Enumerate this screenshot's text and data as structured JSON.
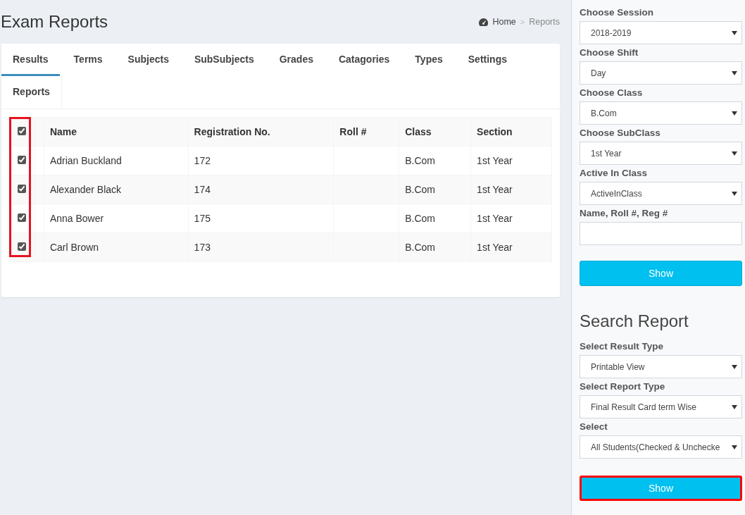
{
  "page": {
    "title": "Exam Reports",
    "breadcrumb": [
      {
        "label": "Home",
        "kind": "link"
      },
      {
        "label": "Reports",
        "kind": "current"
      }
    ],
    "breadcrumb_separator": ">"
  },
  "tabs": [
    {
      "label": "Results",
      "selected": true
    },
    {
      "label": "Terms",
      "selected": false
    },
    {
      "label": "Subjects",
      "selected": false
    },
    {
      "label": "SubSubjects",
      "selected": false
    },
    {
      "label": "Grades",
      "selected": false
    },
    {
      "label": "Catagories",
      "selected": false
    },
    {
      "label": "Types",
      "selected": false
    },
    {
      "label": "Settings",
      "selected": false
    },
    {
      "label": "Reports",
      "selected": false
    }
  ],
  "table": {
    "select_all_checked": true,
    "checkbox_column_highlighted": true,
    "columns": [
      "Name",
      "Registration No.",
      "Roll #",
      "Class",
      "Section"
    ],
    "rows": [
      {
        "checked": true,
        "cells": [
          "Adrian Buckland",
          "172",
          "",
          "B.Com",
          "1st Year"
        ]
      },
      {
        "checked": true,
        "cells": [
          "Alexander Black",
          "174",
          "",
          "B.Com",
          "1st Year"
        ]
      },
      {
        "checked": true,
        "cells": [
          "Anna Bower",
          "175",
          "",
          "B.Com",
          "1st Year"
        ]
      },
      {
        "checked": true,
        "cells": [
          "Carl Brown",
          "173",
          "",
          "B.Com",
          "1st Year"
        ]
      }
    ]
  },
  "sidebar": {
    "filters": [
      {
        "label": "Choose Session",
        "kind": "select",
        "value": "2018-2019"
      },
      {
        "label": "Choose Shift",
        "kind": "select",
        "value": "Day"
      },
      {
        "label": "Choose Class",
        "kind": "select",
        "value": "B.Com"
      },
      {
        "label": "Choose SubClass",
        "kind": "select",
        "value": "1st Year"
      },
      {
        "label": "Active In Class",
        "kind": "select",
        "value": "ActiveInClass"
      },
      {
        "label": "Name, Roll #, Reg #",
        "kind": "text"
      }
    ],
    "filter_button": {
      "label": "Show",
      "highlighted": false
    },
    "report_heading": "Search Report",
    "report_fields": [
      {
        "label": "Select Result Type",
        "kind": "select",
        "value": "Printable View"
      },
      {
        "label": "Select Report Type",
        "kind": "select",
        "value": "Final Result Card term Wise"
      },
      {
        "label": "Select",
        "kind": "select",
        "value": "All Students(Checked & Unchecke"
      }
    ],
    "report_button": {
      "label": "Show",
      "highlighted": true
    }
  }
}
